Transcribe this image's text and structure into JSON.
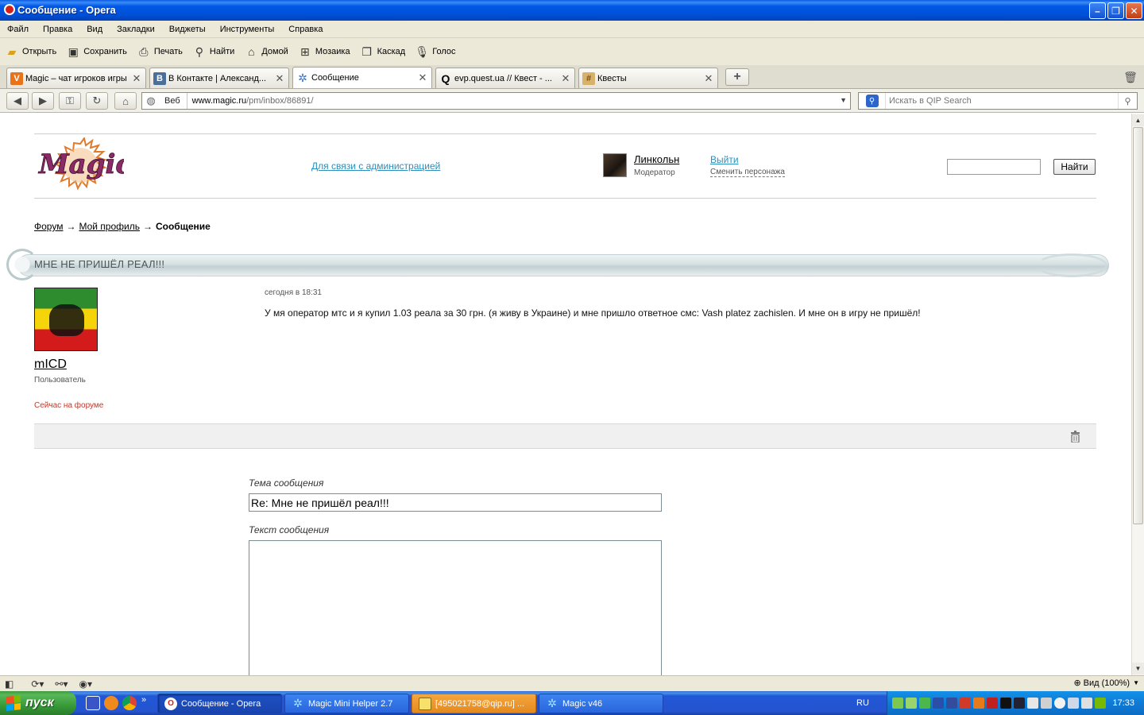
{
  "window": {
    "title": "Сообщение - Opera"
  },
  "menu": [
    "Файл",
    "Правка",
    "Вид",
    "Закладки",
    "Виджеты",
    "Инструменты",
    "Справка"
  ],
  "toolbar": {
    "open": "Открыть",
    "save": "Сохранить",
    "print": "Печать",
    "find": "Найти",
    "home": "Домой",
    "tile": "Мозаика",
    "cascade": "Каскад",
    "voice": "Голос"
  },
  "tabs": [
    {
      "label": "Magic – чат игроков игры",
      "icon": "magic-favicon"
    },
    {
      "label": "В Контакте | Александ...",
      "icon": "vk-favicon"
    },
    {
      "label": "Сообщение",
      "icon": "magic-gear-favicon"
    },
    {
      "label": "evp.quest.ua // Квест - ...",
      "icon": "search-favicon"
    },
    {
      "label": "Квесты",
      "icon": "quest-favicon"
    }
  ],
  "address": {
    "web_label": "Веб",
    "url_host": "www.magic.ru",
    "url_path": "/pm/inbox/86891/",
    "search_placeholder": "Искать в QIP Search"
  },
  "header": {
    "admin_link": "Для связи с администрацией",
    "user_name": "Линкольн",
    "user_role": "Модератор",
    "logout": "Выйти",
    "switch_character": "Сменить персонажа",
    "search_button": "Найти"
  },
  "breadcrumb": {
    "forum": "Форум",
    "profile": "Мой профиль",
    "current": "Сообщение",
    "separator": "→"
  },
  "topic": {
    "title": "МНЕ НЕ ПРИШЁЛ РЕАЛ!!!"
  },
  "message": {
    "author": "mICD",
    "author_role": "Пользователь",
    "online_status": "Сейчас на форуме",
    "date": "сегодня в 18:31",
    "body": "У мя оператор мтс и я купил 1.03 реала за 30 грн. (я живу в Украине) и мне пришло ответное смс: Vash platez zachislen. И мне он в игру не пришёл!"
  },
  "reply_form": {
    "subject_label": "Тема сообщения",
    "subject_value": "Re: Мне не пришёл реал!!!",
    "body_label": "Текст сообщения",
    "body_value": ""
  },
  "statusbar": {
    "zoom": "Вид (100%)"
  },
  "taskbar": {
    "start": "пуск",
    "tasks": [
      {
        "label": "Сообщение - Opera",
        "icon": "opera-icon"
      },
      {
        "label": "Magic Mini Helper 2.7",
        "icon": "magic-icon"
      },
      {
        "label": "[495021758@qip.ru] ...",
        "icon": "qip-icon"
      },
      {
        "label": "Magic v46",
        "icon": "magic-icon"
      }
    ],
    "language": "RU",
    "clock": "17:33"
  }
}
